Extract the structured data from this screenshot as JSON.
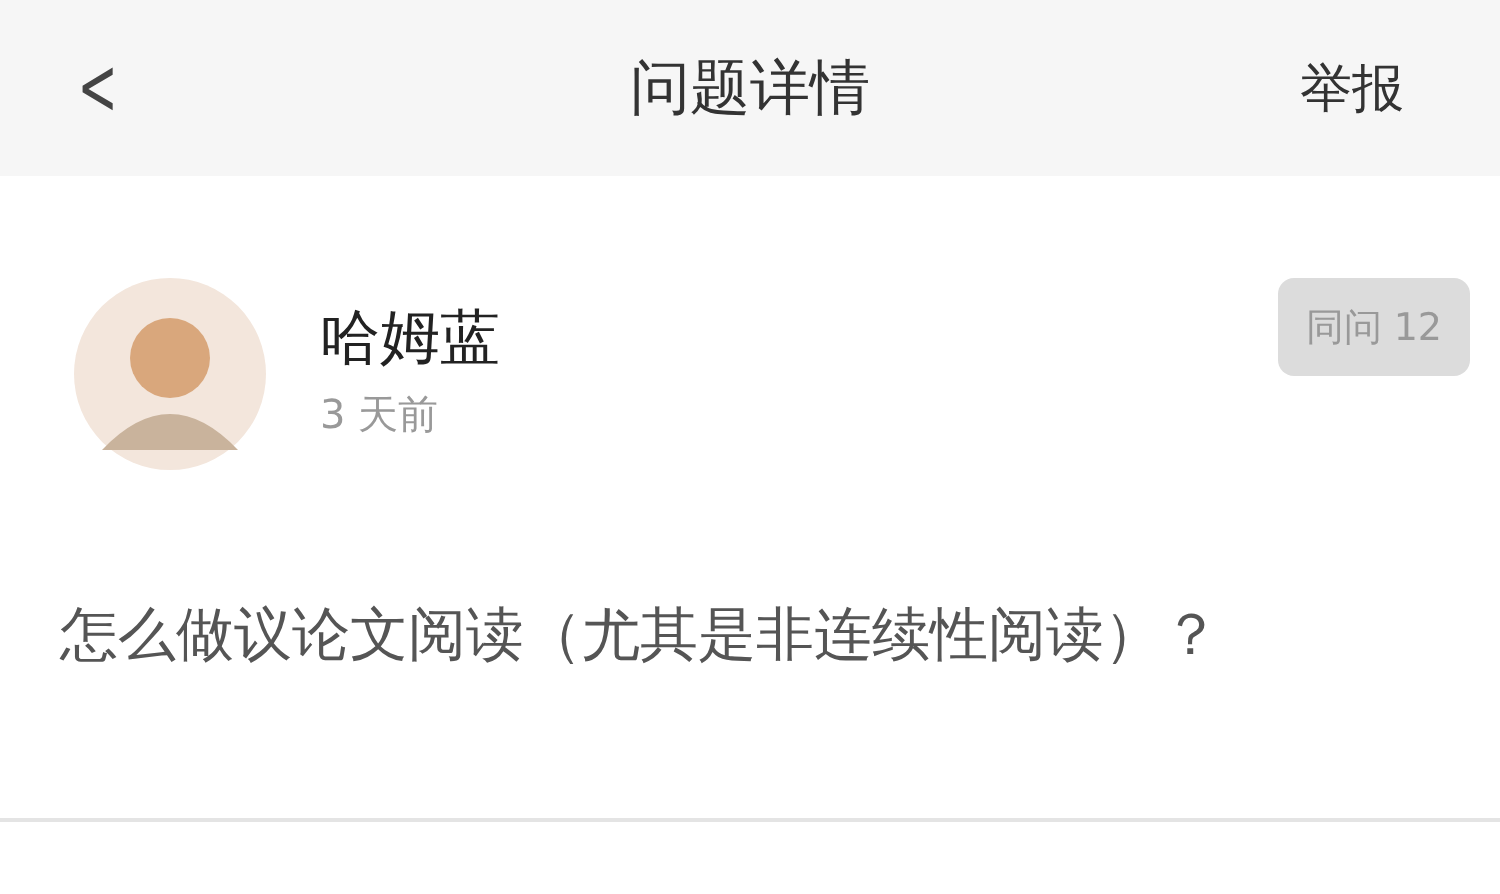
{
  "header": {
    "back_icon": "<",
    "title": "问题详情",
    "action": "举报"
  },
  "author": {
    "name": "哈姆蓝",
    "time": "3 天前"
  },
  "follow_button": {
    "label": "同问 12"
  },
  "question": "怎么做议论文阅读（尤其是非连续性阅读）？"
}
